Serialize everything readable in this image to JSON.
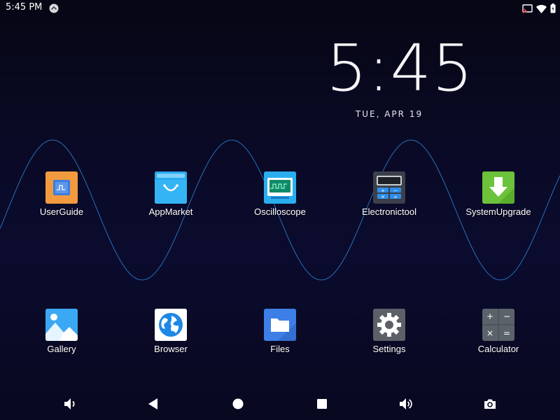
{
  "status_bar": {
    "time": "5:45 PM",
    "icons": [
      "notification-icon",
      "cast-icon",
      "wifi-icon",
      "battery-icon"
    ]
  },
  "clock": {
    "time": "5:45",
    "date": "TUE, APR 19"
  },
  "apps": [
    {
      "label": "UserGuide",
      "icon": "userguide-icon",
      "color": "#f0a04a"
    },
    {
      "label": "AppMarket",
      "icon": "shopping-bag-icon",
      "color": "#2aa8f0"
    },
    {
      "label": "Oscilloscope",
      "icon": "oscilloscope-icon",
      "color": "#2ab0f0"
    },
    {
      "label": "Electronictool",
      "icon": "calculator-device-icon",
      "color": "#3a3f4a"
    },
    {
      "label": "SystemUpgrade",
      "icon": "download-arrow-icon",
      "color": "#6cc23a"
    },
    {
      "label": "Gallery",
      "icon": "gallery-mountain-icon",
      "color": "#3aa8f2"
    },
    {
      "label": "Browser",
      "icon": "globe-icon",
      "color": "#1e88e5"
    },
    {
      "label": "Files",
      "icon": "folder-icon",
      "color": "#3d7fe6"
    },
    {
      "label": "Settings",
      "icon": "gear-icon",
      "color": "#5a5f68"
    },
    {
      "label": "Calculator",
      "icon": "calculator-icon",
      "color": "#4e545c"
    }
  ],
  "nav_bar": {
    "buttons": [
      "volume-down-icon",
      "back-icon",
      "home-icon",
      "recents-icon",
      "volume-up-icon",
      "screenshot-icon"
    ]
  },
  "colors": {
    "wave": "#2f8fe8",
    "background": "#0a0a26"
  }
}
